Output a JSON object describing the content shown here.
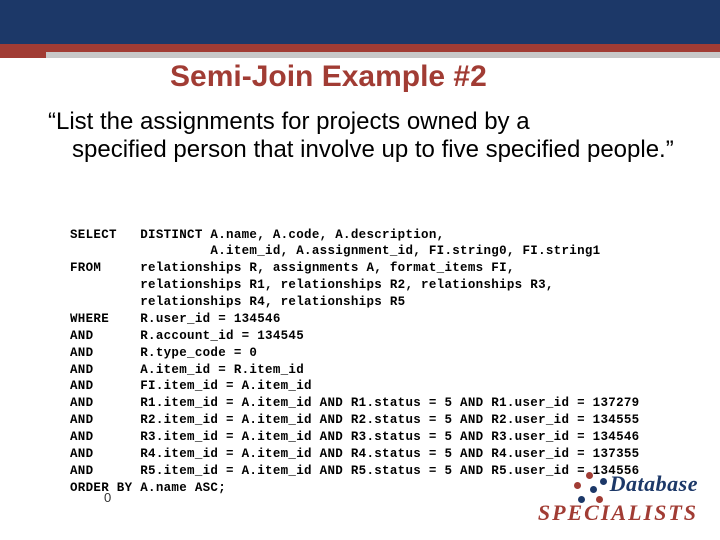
{
  "title": "Semi-Join Example #2",
  "quote_open": "“List the assignments for projects owned by a",
  "quote_rest": "specified person that involve up to five specified people.”",
  "sql_lines": [
    "SELECT   DISTINCT A.name, A.code, A.description,",
    "                  A.item_id, A.assignment_id, FI.string0, FI.string1",
    "FROM     relationships R, assignments A, format_items FI,",
    "         relationships R1, relationships R2, relationships R3,",
    "         relationships R4, relationships R5",
    "WHERE    R.user_id = 134546",
    "AND      R.account_id = 134545",
    "AND      R.type_code = 0",
    "AND      A.item_id = R.item_id",
    "AND      FI.item_id = A.item_id",
    "AND      R1.item_id = A.item_id AND R1.status = 5 AND R1.user_id = 137279",
    "AND      R2.item_id = A.item_id AND R2.status = 5 AND R2.user_id = 134555",
    "AND      R3.item_id = A.item_id AND R3.status = 5 AND R3.user_id = 134546",
    "AND      R4.item_id = A.item_id AND R4.status = 5 AND R4.user_id = 137355",
    "AND      R5.item_id = A.item_id AND R5.status = 5 AND R5.user_id = 134556",
    "ORDER BY A.name ASC;"
  ],
  "page_number": "0",
  "logo": {
    "line1": "Database",
    "line2": "SPECIALISTS"
  }
}
